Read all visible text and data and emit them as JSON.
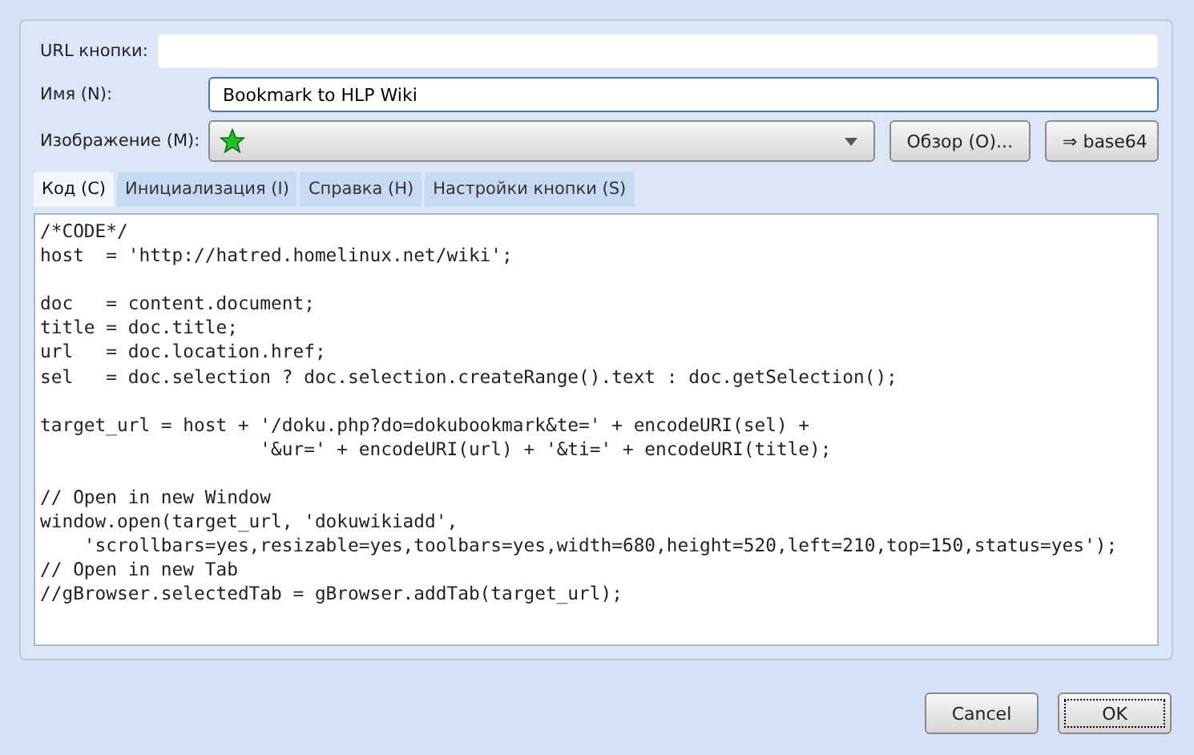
{
  "url_field": {
    "label": "URL кнопки:"
  },
  "name_field": {
    "label": "Имя (N):",
    "value": "Bookmark to HLP Wiki"
  },
  "image_field": {
    "label": "Изображение (M):",
    "browse_button": "Обзор (O)...",
    "base64_button": "⇒ base64"
  },
  "tabs": [
    {
      "label": "Код (C)",
      "selected": true
    },
    {
      "label": "Инициализация (I)",
      "selected": false
    },
    {
      "label": "Справка (H)",
      "selected": false
    },
    {
      "label": "Настройки кнопки (S)",
      "selected": false
    }
  ],
  "code_blocks": [
    [
      "/*CODE*/",
      "host  = 'http://hatred.homelinux.net/wiki';"
    ],
    [
      "doc   = content.document;",
      "title = doc.title;",
      "url   = doc.location.href;",
      "sel   = doc.selection ? doc.selection.createRange().text : doc.getSelection();"
    ],
    [
      "target_url = host + '/doku.php?do=dokubookmark&te=' + encodeURI(sel) +",
      "                    '&ur=' + encodeURI(url) + '&ti=' + encodeURI(title);"
    ],
    [
      "// Open in new Window",
      "window.open(target_url, 'dokuwikiadd',",
      "    'scrollbars=yes,resizable=yes,toolbars=yes,width=680,height=520,left=210,top=150,status=yes');",
      "// Open in new Tab",
      "//gBrowser.selectedTab = gBrowser.addTab(target_url);"
    ]
  ],
  "buttons": [
    {
      "label": "Cancel",
      "focused": false
    },
    {
      "label": "OK",
      "focused": true
    }
  ]
}
